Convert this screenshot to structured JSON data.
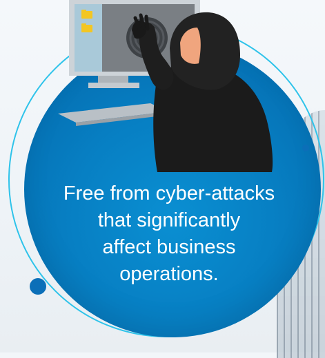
{
  "message": {
    "text": "Free from cyber-attacks\nthat significantly\naffect business\noperations."
  },
  "illustration": {
    "subject": "hooded-hacker-at-computer",
    "icons": [
      "folder-icon",
      "fingerprint-icon",
      "keyboard-icon"
    ]
  },
  "colors": {
    "disc": "#077fc3",
    "ring": "#2ec3ea",
    "accent_dot": "#0b6fb8",
    "text": "#ffffff",
    "hoodie": "#1b1b1b"
  }
}
